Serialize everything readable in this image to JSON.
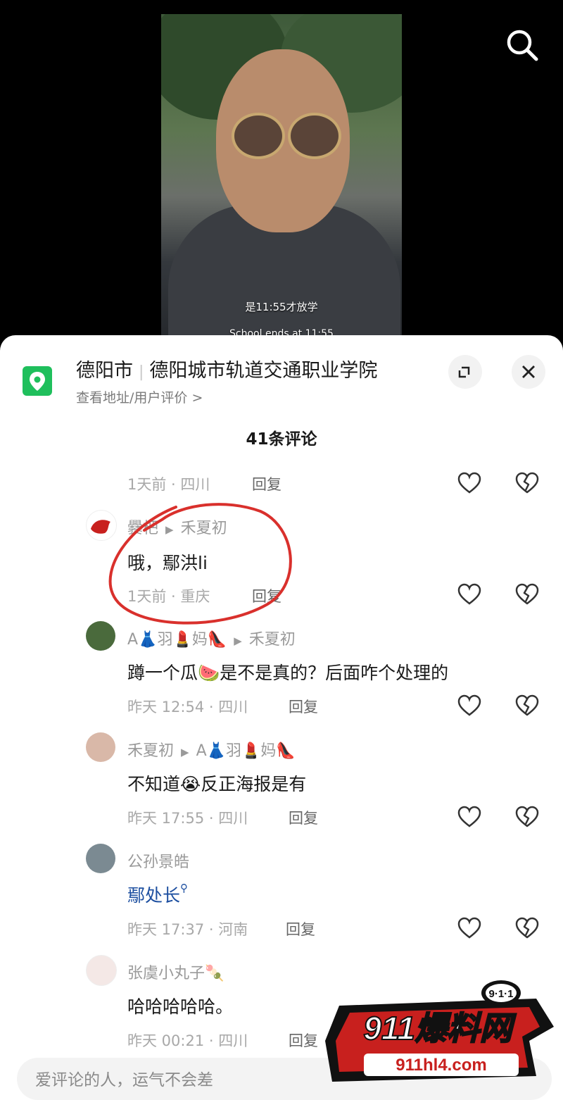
{
  "video": {
    "subtitle_zh": "是11:55才放学",
    "subtitle_en": "School ends at 11:55"
  },
  "location": {
    "city": "德阳市",
    "place": "德阳城市轨道交通职业学院",
    "sub_link": "查看地址/用户评价 >"
  },
  "comments_header": {
    "count_label": "41条评论"
  },
  "comments": [
    {
      "meta": "1天前 · 四川",
      "reply": "回复"
    },
    {
      "name": "爨杷",
      "reply_to": "禾夏初",
      "text": "哦，鄢洪li",
      "meta": "1天前 · 重庆",
      "reply": "回复"
    },
    {
      "name": "A👗羽💄妈👠",
      "reply_to": "禾夏初",
      "text": "蹲一个瓜🍉是不是真的？后面咋个处理的",
      "meta": "昨天 12:54 · 四川",
      "reply": "回复"
    },
    {
      "name": "禾夏初",
      "reply_to": "A👗羽💄妈👠",
      "text": "不知道😭反正海报是有",
      "meta": "昨天 17:55 · 四川",
      "reply": "回复"
    },
    {
      "name": "公孙景皓",
      "text": "鄢处长",
      "meta": "昨天 17:37 · 河南",
      "reply": "回复"
    },
    {
      "name": "张虞小丸子🍡",
      "text": "哈哈哈哈哈。",
      "meta": "昨天 00:21 · 四川",
      "reply": "回复"
    }
  ],
  "input": {
    "placeholder": "爱评论的人，运气不会差"
  },
  "watermark": {
    "badge": "9·1·1",
    "brand": "911爆料网",
    "url": "911hl4.com"
  },
  "colors": {
    "location_green": "#1fbf5c",
    "search_link_blue": "#1d4fa0",
    "annotation_red": "#d9302c"
  }
}
